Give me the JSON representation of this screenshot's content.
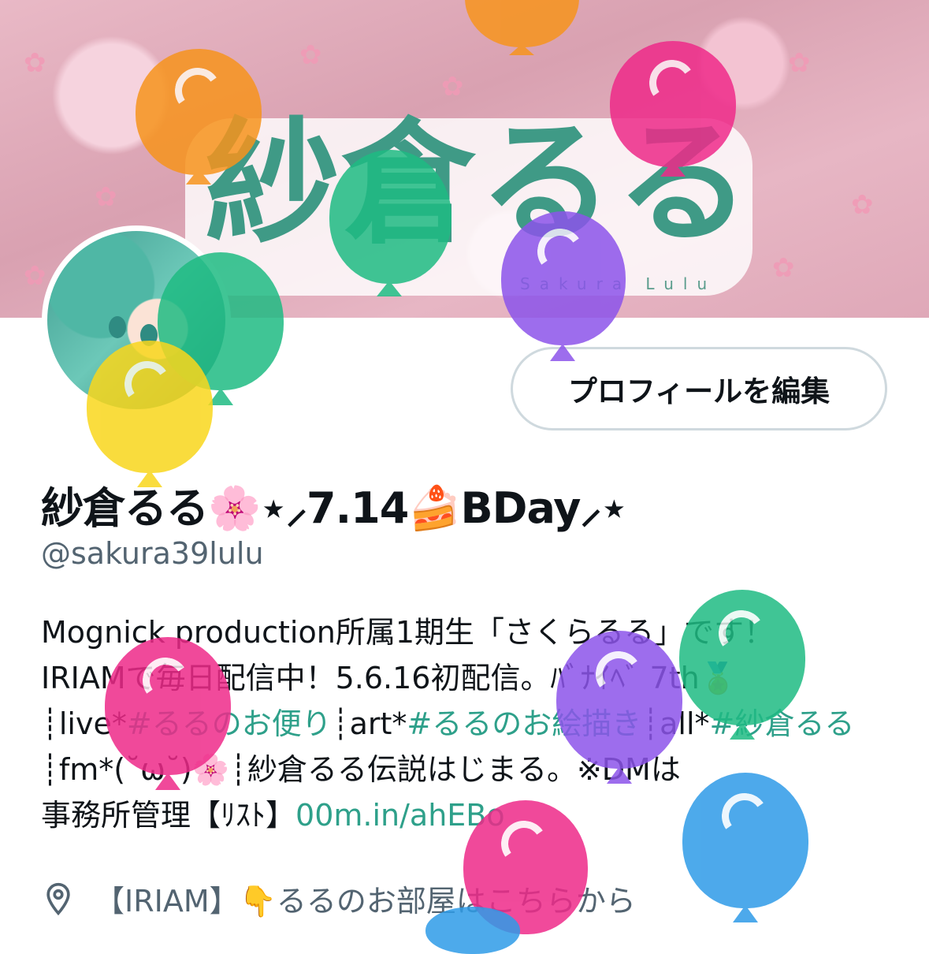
{
  "banner": {
    "logo_text": "紗倉るる",
    "logo_sub": "Sakura Lulu"
  },
  "profile": {
    "edit_button_label": "プロフィールを編集",
    "display_name": "紗倉るる🌸⋆⸝7.14🍰BDay⸝⋆",
    "handle": "@sakura39lulu",
    "bio": {
      "line1": "Mognick production所属1期生「さくらるる」です！",
      "line2_text": "IRIAMで毎日配信中！5.6.16初配信。ﾊﾞﾅｲﾍﾞ 7th🏅",
      "seg_live": "┊live*",
      "tag_letter": "#るるのお便り",
      "seg_art": "┊art*",
      "tag_art": "#るるのお絵描き",
      "seg_all": "┊all*",
      "tag_all": "#紗倉るる",
      "seg_fm": "┊fm*(˘ω˘)🌸┊紗倉るる伝説はじまる。※DMは",
      "seg_manage": "事務所管理【ﾘｽﾄ】",
      "link": "00m.in/ahEBo"
    },
    "location": "【IRIAM】👇るるのお部屋はこちらから"
  },
  "icons": {
    "location": "location-pin-icon",
    "balloon": "balloon-icon"
  },
  "colors": {
    "accent": "#2ea08a",
    "secondary_text": "#536471",
    "logo_green": "#3f9a86"
  }
}
